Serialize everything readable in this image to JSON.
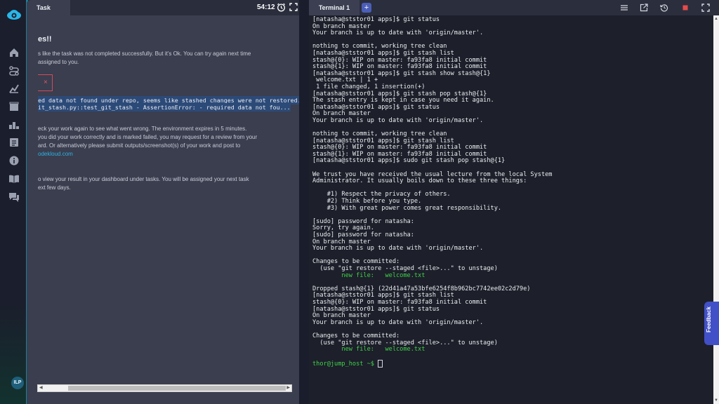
{
  "sidebar": {
    "avatar_initials": "ILP"
  },
  "task": {
    "tab_label": "Task",
    "timer": "54:12",
    "heading": "es!!",
    "lines1": [
      "s like the task was not completed successfully. But it's Ok. You can try again next time",
      "assigned to you."
    ],
    "retry_close": "×",
    "error_lines": [
      "ed data not found under repo, seems like stashed changes were not restored.",
      "it_stash.py::test_git_stash - AssertionError: - required data not fou..."
    ],
    "lines2": [
      "eck your work again to see what went wrong. The environment expires in 5 minutes.",
      "you did your work correctly and is marked failed, you may request for a review from your",
      "ard. Or alternatively please submit outputs/screenshot(s) of your work and post to"
    ],
    "link_text": "odekloud.com",
    "lines3": [
      "o view your result in your dashboard under tasks. You will be assigned your next task",
      "ext few days."
    ]
  },
  "terminal": {
    "tab_label": "Terminal 1",
    "add_label": "+",
    "lines": [
      {
        "t": "[natasha@ststor01 apps]$ git status"
      },
      {
        "t": "On branch master"
      },
      {
        "t": "Your branch is up to date with 'origin/master'."
      },
      {
        "t": ""
      },
      {
        "t": "nothing to commit, working tree clean"
      },
      {
        "t": "[natasha@ststor01 apps]$ git stash list"
      },
      {
        "t": "stash@{0}: WIP on master: fa93fa8 initial commit"
      },
      {
        "t": "stash@{1}: WIP on master: fa93fa8 initial commit"
      },
      {
        "t": "[natasha@ststor01 apps]$ git stash show stash@{1}"
      },
      {
        "t": " welcome.txt | 1 +"
      },
      {
        "t": " 1 file changed, 1 insertion(+)"
      },
      {
        "t": "[natasha@ststor01 apps]$ git stash pop stash@{1}"
      },
      {
        "t": "The stash entry is kept in case you need it again."
      },
      {
        "t": "[natasha@ststor01 apps]$ git status"
      },
      {
        "t": "On branch master"
      },
      {
        "t": "Your branch is up to date with 'origin/master'."
      },
      {
        "t": ""
      },
      {
        "t": "nothing to commit, working tree clean"
      },
      {
        "t": "[natasha@ststor01 apps]$ git stash list"
      },
      {
        "t": "stash@{0}: WIP on master: fa93fa8 initial commit"
      },
      {
        "t": "stash@{1}: WIP on master: fa93fa8 initial commit"
      },
      {
        "t": "[natasha@ststor01 apps]$ sudo git stash pop stash@{1}"
      },
      {
        "t": ""
      },
      {
        "t": "We trust you have received the usual lecture from the local System"
      },
      {
        "t": "Administrator. It usually boils down to these three things:"
      },
      {
        "t": ""
      },
      {
        "t": "    #1) Respect the privacy of others."
      },
      {
        "t": "    #2) Think before you type."
      },
      {
        "t": "    #3) With great power comes great responsibility."
      },
      {
        "t": ""
      },
      {
        "t": "[sudo] password for natasha:"
      },
      {
        "t": "Sorry, try again."
      },
      {
        "t": "[sudo] password for natasha:"
      },
      {
        "t": "On branch master"
      },
      {
        "t": "Your branch is up to date with 'origin/master'."
      },
      {
        "t": ""
      },
      {
        "t": "Changes to be committed:"
      },
      {
        "t": "  (use \"git restore --staged <file>...\" to unstage)"
      },
      {
        "t": "        new file:   welcome.txt",
        "green": true
      },
      {
        "t": ""
      },
      {
        "t": "Dropped stash@{1} (22d41a47a53bfe6254f8b962bc7742ee02c2d79e)"
      },
      {
        "t": "[natasha@ststor01 apps]$ git stash list"
      },
      {
        "t": "stash@{0}: WIP on master: fa93fa8 initial commit"
      },
      {
        "t": "[natasha@ststor01 apps]$ git status"
      },
      {
        "t": "On branch master"
      },
      {
        "t": "Your branch is up to date with 'origin/master'."
      },
      {
        "t": ""
      },
      {
        "t": "Changes to be committed:"
      },
      {
        "t": "  (use \"git restore --staged <file>...\" to unstage)"
      },
      {
        "t": "        new file:   welcome.txt",
        "green": true
      },
      {
        "t": ""
      },
      {
        "t": "thor@jump_host ~$ ",
        "prompt": true
      }
    ]
  },
  "feedback": {
    "label": "Feedback"
  },
  "colors": {
    "accent": "#1aa6c9",
    "prompt_green": "#3fd34a",
    "selection": "#2c4a78",
    "error": "#e25565"
  }
}
